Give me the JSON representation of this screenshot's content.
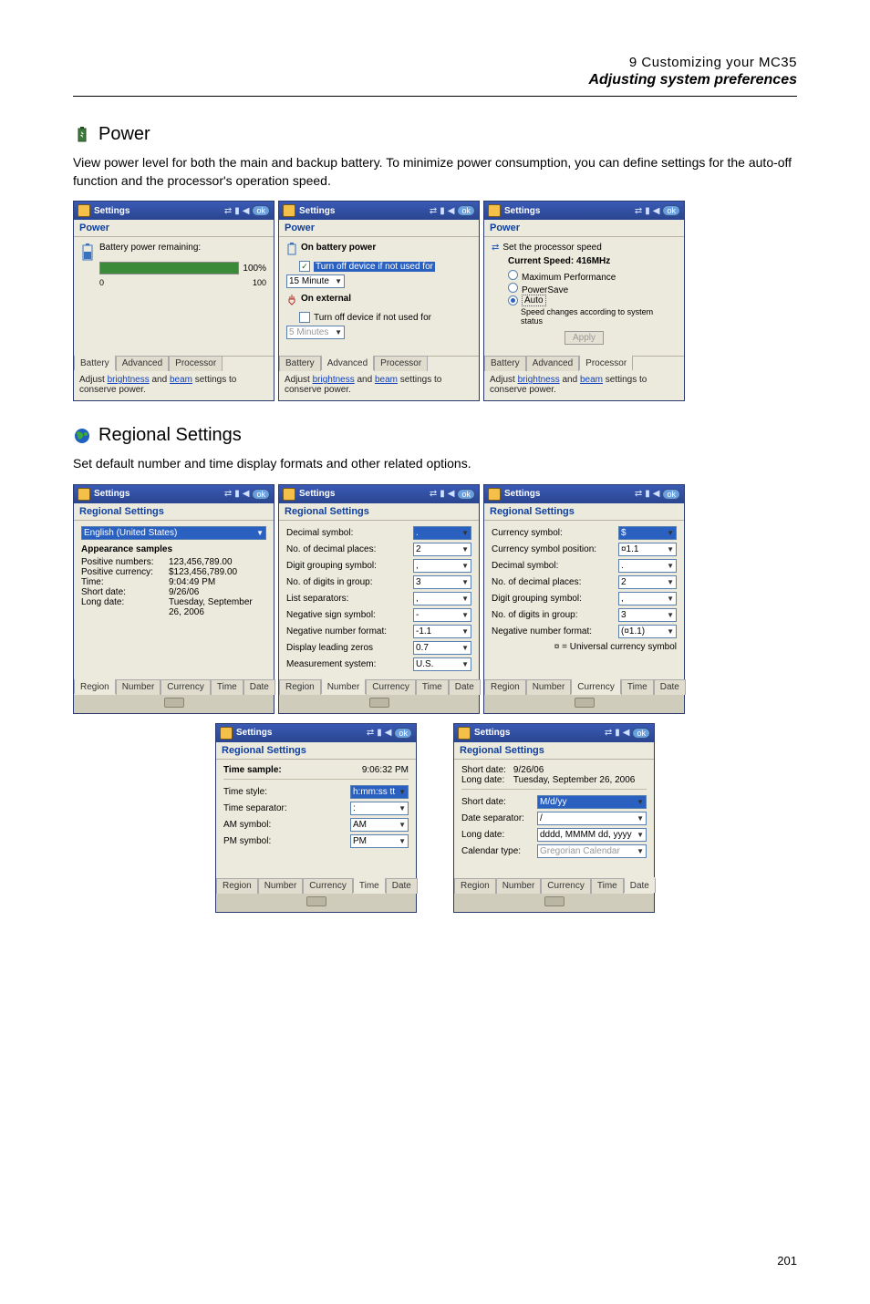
{
  "header": {
    "chapter": "9 Customizing your MC35",
    "section": "Adjusting system preferences"
  },
  "power": {
    "title": "Power",
    "desc": "View power level for both the main and backup battery. To minimize power consumption, you can define settings for the auto-off function and the processor's operation speed.",
    "win_title": "Settings",
    "sub": "Power",
    "ok": "ok",
    "tabs": [
      "Battery",
      "Advanced",
      "Processor"
    ],
    "foot_prefix": "Adjust ",
    "foot_link1": "brightness",
    "foot_mid": " and ",
    "foot_link2": "beam",
    "foot_suffix": " settings to conserve power.",
    "a": {
      "remaining": "Battery power remaining:",
      "pct": "100%",
      "zero": "0",
      "hundred": "100"
    },
    "b": {
      "on_batt": "On battery power",
      "turnoff": "Turn off device if not used for",
      "d1": "15 Minute",
      "on_ext": "On external",
      "d2": "5 Minutes"
    },
    "c": {
      "set": "Set the processor speed",
      "cur": "Current Speed: 416MHz",
      "r1": "Maximum Performance",
      "r2": "PowerSave",
      "r3": "Auto",
      "note": "Speed changes according to system status",
      "apply": "Apply"
    }
  },
  "regional": {
    "title": "Regional Settings",
    "desc": "Set default number and time display formats and other related options.",
    "win_title": "Settings",
    "sub": "Regional Settings",
    "tabs5": [
      "Region",
      "Number",
      "Currency",
      "Time",
      "Date"
    ],
    "a": {
      "locale": "English (United States)",
      "app": "Appearance samples",
      "rows": [
        [
          "Positive numbers:",
          "123,456,789.00"
        ],
        [
          "Positive currency:",
          "$123,456,789.00"
        ],
        [
          "Time:",
          "9:04:49 PM"
        ],
        [
          "Short date:",
          "9/26/06"
        ],
        [
          "Long date:",
          "Tuesday, September 26, 2006"
        ]
      ]
    },
    "b": {
      "rows": [
        [
          "Decimal symbol:",
          "."
        ],
        [
          "No. of decimal places:",
          "2"
        ],
        [
          "Digit grouping symbol:",
          ","
        ],
        [
          "No. of digits in group:",
          "3"
        ],
        [
          "List separators:",
          ","
        ],
        [
          "Negative sign symbol:",
          "-"
        ],
        [
          "Negative number format:",
          "-1.1"
        ],
        [
          "Display leading zeros",
          "0.7"
        ],
        [
          "Measurement system:",
          "U.S."
        ]
      ]
    },
    "c": {
      "rows": [
        [
          "Currency symbol:",
          "$"
        ],
        [
          "Currency symbol position:",
          "¤1.1"
        ],
        [
          "Decimal symbol:",
          "."
        ],
        [
          "No. of decimal places:",
          "2"
        ],
        [
          "Digit grouping symbol:",
          ","
        ],
        [
          "No. of digits in group:",
          "3"
        ],
        [
          "Negative number format:",
          "(¤1.1)"
        ]
      ],
      "note": "¤ = Universal currency symbol"
    },
    "d": {
      "sample_lbl": "Time sample:",
      "sample_val": "9:06:32 PM",
      "rows": [
        [
          "Time style:",
          "h:mm:ss tt"
        ],
        [
          "Time separator:",
          ":"
        ],
        [
          "AM symbol:",
          "AM"
        ],
        [
          "PM symbol:",
          "PM"
        ]
      ]
    },
    "e": {
      "sd_lbl": "Short date:",
      "sd_val": "9/26/06",
      "ld_lbl": "Long date:",
      "ld_val": "Tuesday, September 26, 2006",
      "rows": [
        [
          "Short date:",
          "M/d/yy"
        ],
        [
          "Date separator:",
          "/"
        ],
        [
          "Long date:",
          "dddd, MMMM dd, yyyy"
        ],
        [
          "Calendar type:",
          "Gregorian Calendar"
        ]
      ]
    }
  },
  "pagenum": "201"
}
